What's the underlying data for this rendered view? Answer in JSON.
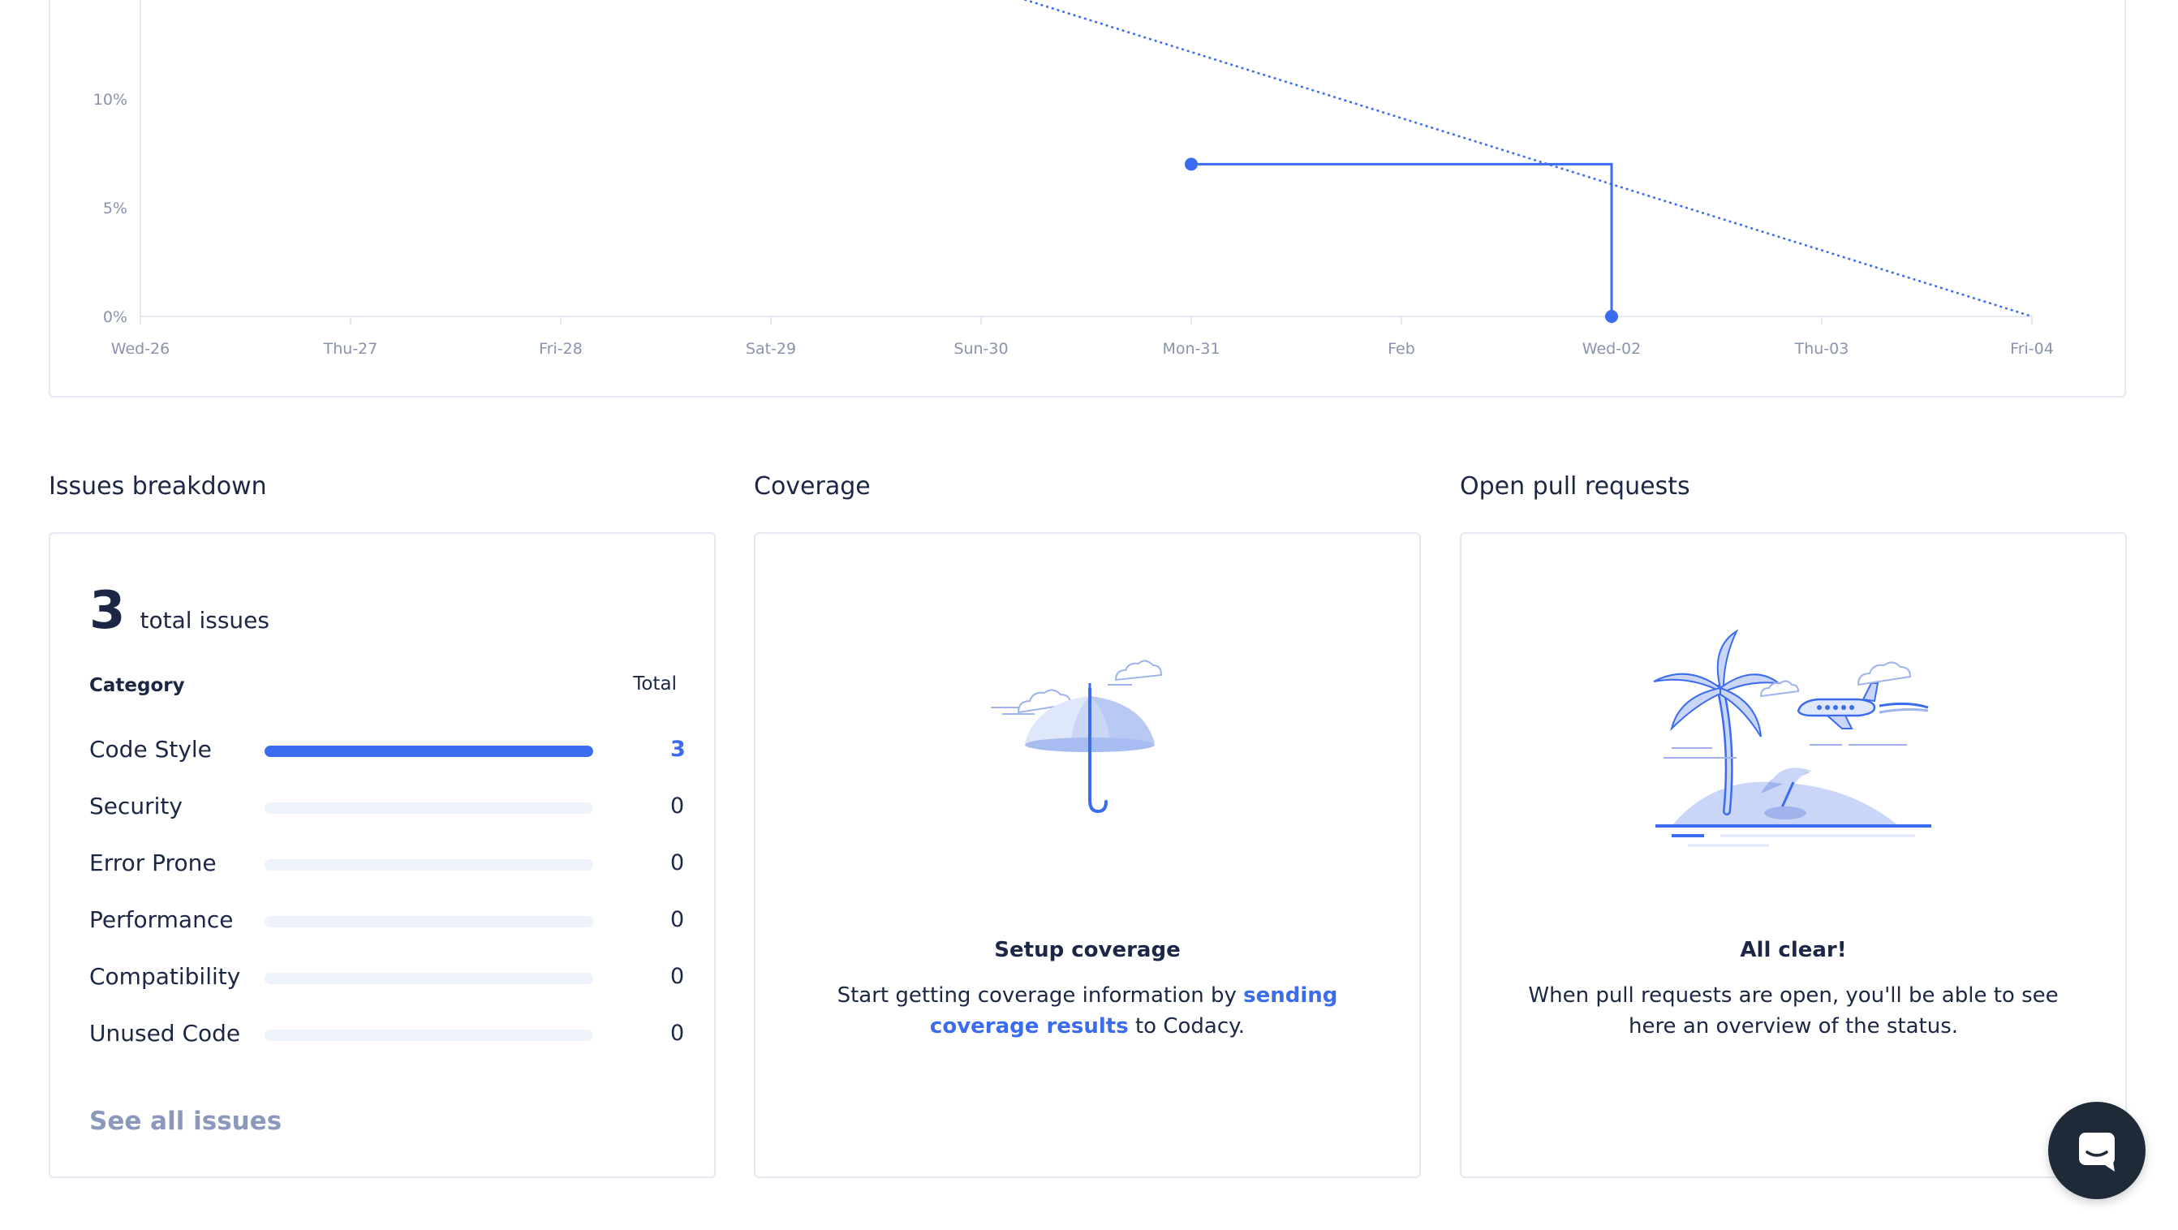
{
  "chart_data": {
    "type": "line",
    "x_ticks": [
      "Wed-26",
      "Thu-27",
      "Fri-28",
      "Sat-29",
      "Sun-30",
      "Mon-31",
      "Feb",
      "Wed-02",
      "Thu-03",
      "Fri-04"
    ],
    "y_ticks": [
      "0%",
      "5%",
      "10%"
    ],
    "ylim": [
      0,
      15
    ],
    "series": [
      {
        "style": "solid-step",
        "color": "#3b6cf0",
        "points": [
          {
            "x": "Mon-31",
            "y": 7
          },
          {
            "x": "Wed-02",
            "y": 0
          }
        ]
      },
      {
        "style": "dotted",
        "color": "#3b6cf0",
        "points": [
          {
            "x": "Sun-30",
            "y": 15.2
          },
          {
            "x": "Fri-04",
            "y": 0
          }
        ]
      }
    ],
    "grid": false
  },
  "issues": {
    "section_title": "Issues breakdown",
    "total_count": "3",
    "total_label": "total issues",
    "category_header": "Category",
    "total_header": "Total",
    "categories": [
      {
        "label": "Code Style",
        "value": "3",
        "fraction": 1.0
      },
      {
        "label": "Security",
        "value": "0",
        "fraction": 0
      },
      {
        "label": "Error Prone",
        "value": "0",
        "fraction": 0
      },
      {
        "label": "Performance",
        "value": "0",
        "fraction": 0
      },
      {
        "label": "Compatibility",
        "value": "0",
        "fraction": 0
      },
      {
        "label": "Unused Code",
        "value": "0",
        "fraction": 0
      }
    ],
    "see_all_label": "See all issues"
  },
  "coverage": {
    "section_title": "Coverage",
    "empty_title": "Setup coverage",
    "text_before": "Start getting coverage information by ",
    "link_text": "sending coverage results",
    "text_after": " to Codacy.",
    "illustration_icon": "umbrella-icon"
  },
  "pull_requests": {
    "section_title": "Open pull requests",
    "empty_title": "All clear!",
    "text": "When pull requests are open, you'll be able to see here an overview of the status.",
    "illustration_icon": "island-icon"
  },
  "chat": {
    "icon": "chat-icon"
  },
  "colors": {
    "accent": "#3b6cf0",
    "muted_link": "#8a98bc",
    "text": "#1b2744",
    "border": "#e4e9f2"
  }
}
